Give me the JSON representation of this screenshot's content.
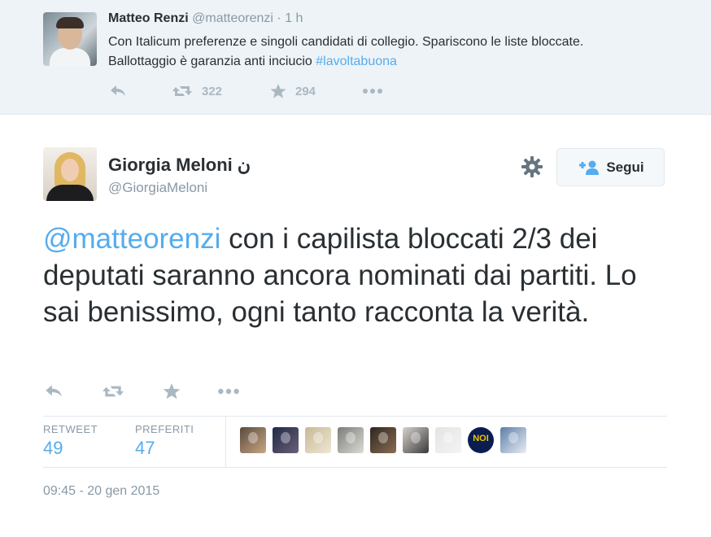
{
  "ancestor_tweet": {
    "author_name": "Matteo Renzi",
    "author_handle": "@matteorenzi",
    "separator": "·",
    "time": "1 h",
    "text_before": "Con Italicum preferenze e singoli candidati di collegio. Spariscono le liste bloccate. Ballottaggio è garanzia anti inciucio ",
    "hashtag": "#lavoltabuona",
    "retweet_count": "322",
    "favorite_count": "294"
  },
  "main_tweet": {
    "author_name": "Giorgia Meloni",
    "name_suffix": "ن",
    "author_handle": "@GiorgiaMeloni",
    "follow_label": "Segui",
    "mention": "@matteorenzi",
    "text": " con i capilista bloccati 2/3 dei deputati saranno ancora nominati dai partiti. Lo sai benissimo, ogni tanto racconta la verità.",
    "stats": {
      "retweet_label": "RETWEET",
      "retweet_count": "49",
      "favorites_label": "PREFERITI",
      "favorites_count": "47"
    },
    "favoriter_avatars": [
      {
        "colors": [
          "#5a4a3c",
          "#c9a784"
        ]
      },
      {
        "colors": [
          "#1f2a44",
          "#6b5f7a"
        ]
      },
      {
        "colors": [
          "#c8b894",
          "#efe7d6"
        ]
      },
      {
        "colors": [
          "#7a7d78",
          "#dcdcd4"
        ]
      },
      {
        "colors": [
          "#2e2620",
          "#8a6d52"
        ]
      },
      {
        "colors": [
          "#d8d2cc",
          "#3a3a3a"
        ]
      },
      {
        "colors": [
          "#e4e4e4",
          "#f4f4f4"
        ]
      },
      {
        "colors": [
          "#0b1d4f",
          "#f0c400"
        ],
        "text": "NOI"
      },
      {
        "colors": [
          "#5d7ea8",
          "#e9eef4"
        ]
      }
    ],
    "timestamp": "09:45 - 20 gen 2015"
  },
  "colors": {
    "link": "#55acee",
    "muted": "#8899a6",
    "icon": "#aab8c2",
    "text": "#292f33"
  }
}
